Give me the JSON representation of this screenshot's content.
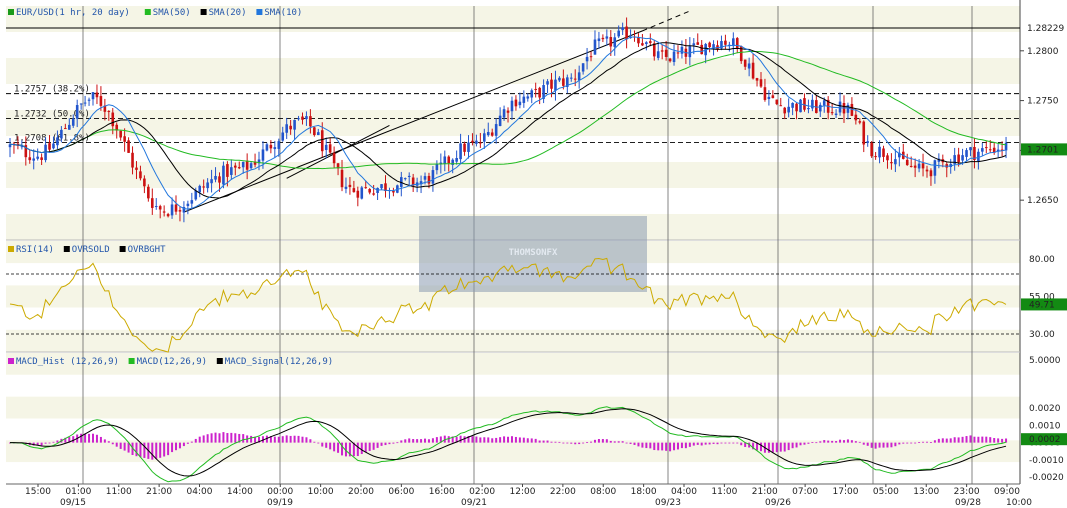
{
  "chart_data": [
    {
      "type": "candlestick",
      "panel": "price",
      "legend": [
        {
          "label": "EUR/USD(1 hr,  20 day)",
          "color": "#1a9a1a"
        },
        {
          "label": "SMA(50)",
          "color": "#22bb22"
        },
        {
          "label": "SMA(20)",
          "color": "#000000"
        },
        {
          "label": "SMA(10)",
          "color": "#2277dd"
        }
      ],
      "ylim": [
        1.261,
        1.2845
      ],
      "ticks": [
        "1.2800",
        "1.2750",
        "1.2700",
        "1.2650"
      ],
      "tick_values": [
        1.28,
        1.275,
        1.27,
        1.265
      ],
      "current_price": {
        "label": "1.2701",
        "value": 1.2701
      },
      "top_value": {
        "label": "1.28229",
        "value": 1.28229
      },
      "fib_levels": [
        {
          "label": "1.2757 (38.2%)",
          "value": 1.2757
        },
        {
          "label": "1.2732 (50.0%)",
          "value": 1.2732
        },
        {
          "label": "1.2708 (61.8%)",
          "value": 1.2708
        }
      ],
      "watermark": "THOMSONFX",
      "candle_up_color": "#2255cc",
      "candle_down_color": "#cc1111",
      "trend_anchors": [
        {
          "i": 0,
          "v": 1.2704
        },
        {
          "i": 8,
          "v": 1.2695
        },
        {
          "i": 22,
          "v": 1.2752
        },
        {
          "i": 40,
          "v": 1.264
        },
        {
          "i": 58,
          "v": 1.268
        },
        {
          "i": 75,
          "v": 1.2728
        },
        {
          "i": 88,
          "v": 1.266
        },
        {
          "i": 104,
          "v": 1.2668
        },
        {
          "i": 118,
          "v": 1.2705
        },
        {
          "i": 130,
          "v": 1.2752
        },
        {
          "i": 142,
          "v": 1.277
        },
        {
          "i": 150,
          "v": 1.2805
        },
        {
          "i": 158,
          "v": 1.2818
        },
        {
          "i": 166,
          "v": 1.2793
        },
        {
          "i": 182,
          "v": 1.281
        },
        {
          "i": 196,
          "v": 1.2745
        },
        {
          "i": 212,
          "v": 1.2742
        },
        {
          "i": 220,
          "v": 1.27
        },
        {
          "i": 232,
          "v": 1.268
        },
        {
          "i": 244,
          "v": 1.2698
        },
        {
          "i": 252,
          "v": 1.2703
        }
      ]
    },
    {
      "type": "line",
      "panel": "rsi",
      "legend": [
        {
          "label": "RSI(14)",
          "color": "#ccaa00"
        },
        {
          "label": "OVRSOLD",
          "color": "#000000"
        },
        {
          "label": "OVRBGHT",
          "color": "#000000"
        }
      ],
      "ylim": [
        18,
        92
      ],
      "ticks": [
        "80.00",
        "55.00",
        "30.00"
      ],
      "tick_values": [
        80,
        55,
        30
      ],
      "levels": [
        70,
        30
      ],
      "current": {
        "label": "49.71",
        "value": 49.71
      }
    },
    {
      "type": "macd",
      "panel": "macd",
      "legend": [
        {
          "label": "MACD_Hist (12,26,9)",
          "color": "#cc22cc"
        },
        {
          "label": "MACD(12,26,9)",
          "color": "#22bb22"
        },
        {
          "label": "MACD_Signal(12,26,9)",
          "color": "#000000"
        }
      ],
      "ylim": [
        -0.0024,
        0.0052
      ],
      "ticks": [
        "5.0000",
        "0.0020",
        "0.0010",
        "0.0000",
        "-0.0010",
        "-0.0020"
      ],
      "tick_values": [
        0.0048,
        0.002,
        0.001,
        0.0,
        -0.001,
        -0.002
      ],
      "current": {
        "label": "0.0002",
        "value": 0.0002
      }
    }
  ],
  "x_axis": {
    "time_labels": [
      "15:00",
      "01:00",
      "11:00",
      "21:00",
      "04:00",
      "14:00",
      "00:00",
      "10:00",
      "20:00",
      "06:00",
      "16:00",
      "02:00",
      "12:00",
      "22:00",
      "08:00",
      "18:00",
      "04:00",
      "11:00",
      "21:00",
      "07:00",
      "17:00",
      "05:00",
      "13:00",
      "23:00",
      "09:00"
    ],
    "date_labels": [
      "09/15",
      "09/19",
      "09/21",
      "09/23",
      "09/26",
      "09/28"
    ],
    "extra_label": "10:00"
  },
  "colors": {
    "band_a": "#f5f5e6",
    "band_b": "#ffffff",
    "current_box": "#138a13",
    "axis_red": "#cc2222"
  }
}
